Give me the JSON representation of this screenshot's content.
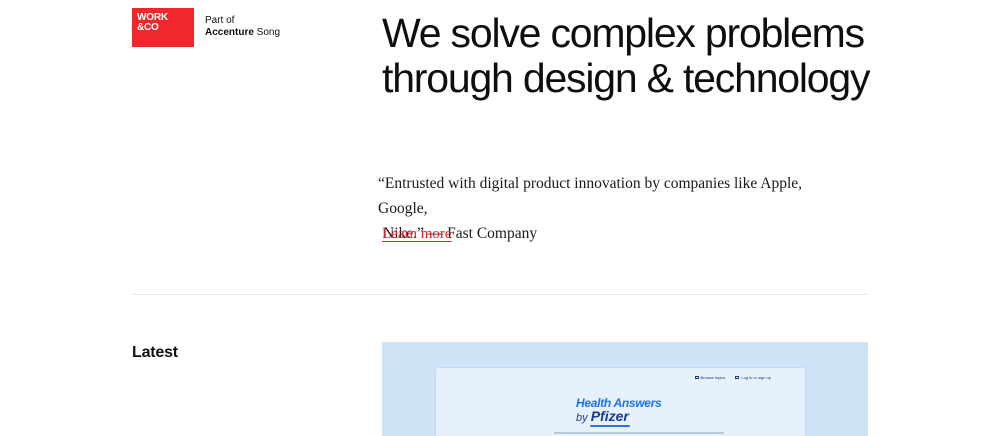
{
  "brand": {
    "logo_line1": "WORK",
    "logo_line2": "&CO",
    "part_of": "Part of",
    "parent_bold": "Accenture",
    "parent_rest": " Song",
    "logo_color": "#f0282d"
  },
  "hero": {
    "title": "We solve complex problems through design & technology",
    "quote": "“Entrusted with digital product innovation by companies like Apple, Google,",
    "quote_line2": "Nike.” — Fast Company",
    "learn_more": "Learn more",
    "link_color": "#d8262c"
  },
  "latest": {
    "label": "Latest",
    "feature": {
      "background": "#cfe3f6",
      "nav_item_1": "Browse topics",
      "nav_item_2": "Log in or sign up",
      "title_line1": "Health Answers",
      "title_by": "by ",
      "title_brand": "Pfizer"
    }
  }
}
